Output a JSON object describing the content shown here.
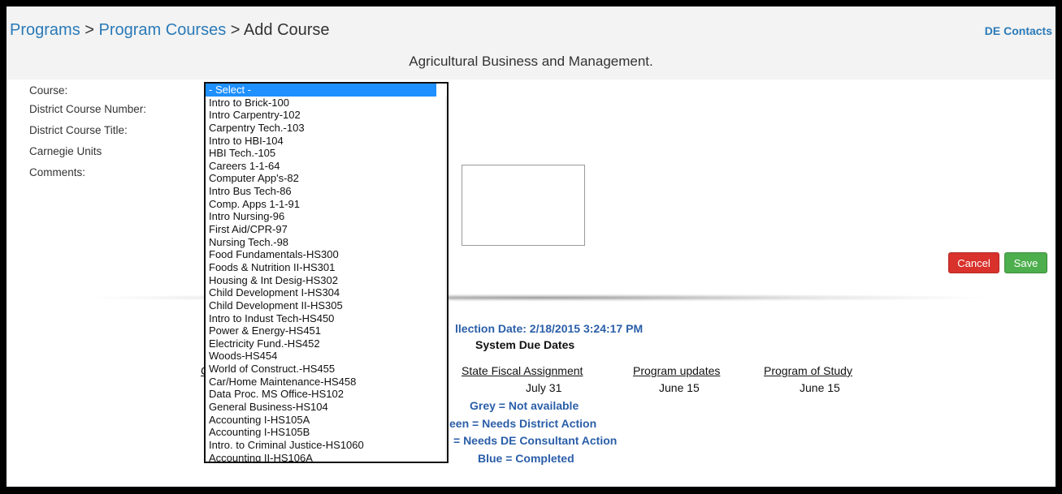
{
  "breadcrumb": {
    "programs": "Programs",
    "sep1": " > ",
    "program_courses": "Program Courses",
    "sep2": " > ",
    "current": "Add Course"
  },
  "header": {
    "de_contacts": "DE Contacts",
    "program_name": "Agricultural Business and Management."
  },
  "form": {
    "labels": {
      "course": "Course:",
      "district_course_number": "District Course Number:",
      "district_course_title": "District Course Title:",
      "carnegie_units": "Carnegie Units",
      "comments": "Comments:"
    },
    "cancel_label": "Cancel",
    "save_label": "Save"
  },
  "course_select": {
    "selected": "- Select -",
    "options": [
      "- Select -",
      "Intro to Brick-100",
      "Intro Carpentry-102",
      "Carpentry Tech.-103",
      "Intro to HBI-104",
      "HBI Tech.-105",
      "Careers 1-1-64",
      "Computer App's-82",
      "Intro Bus Tech-86",
      "Comp. Apps 1-1-91",
      "Intro Nursing-96",
      "First Aid/CPR-97",
      "Nursing Tech.-98",
      "Food Fundamentals-HS300",
      "Foods & Nutrition II-HS301",
      "Housing & Int Desig-HS302",
      "Child Development I-HS304",
      "Child Development II-HS305",
      "Intro to Indust Tech-HS450",
      "Power & Energy-HS451",
      "Electricity Fund.-HS452",
      "Woods-HS454",
      "World of Construct.-HS455",
      "Car/Home Maintenance-HS458",
      "Data Proc. MS Office-HS102",
      "General Business-HS104",
      "Accounting I-HS105A",
      "Accounting I-HS105B",
      "Intro. to Criminal Justice-HS1060",
      "Accounting II-HS106A"
    ]
  },
  "info": {
    "collection_date": "llection Date: 2/18/2015 3:24:17 PM",
    "system_due_dates": "System Due Dates",
    "clipped_col": "C",
    "columns": [
      {
        "header": "State Fiscal Assignment",
        "value": "July 31"
      },
      {
        "header": "Program updates",
        "value": "June 15"
      },
      {
        "header": "Program of Study",
        "value": "June 15"
      }
    ],
    "legend": {
      "grey": "Grey = Not available",
      "green": "een = Needs District Action",
      "consultant": "= Needs DE Consultant Action",
      "blue": "Blue = Completed"
    }
  },
  "colors": {
    "link": "#2a7ab8",
    "info_text": "#2a5ea8",
    "cancel": "#d9312b",
    "save": "#4cae4c",
    "selected_option": "#1e90ff"
  },
  "icons": {
    "scroll_up": "chevron-up-icon",
    "scroll_down": "chevron-down-icon"
  }
}
